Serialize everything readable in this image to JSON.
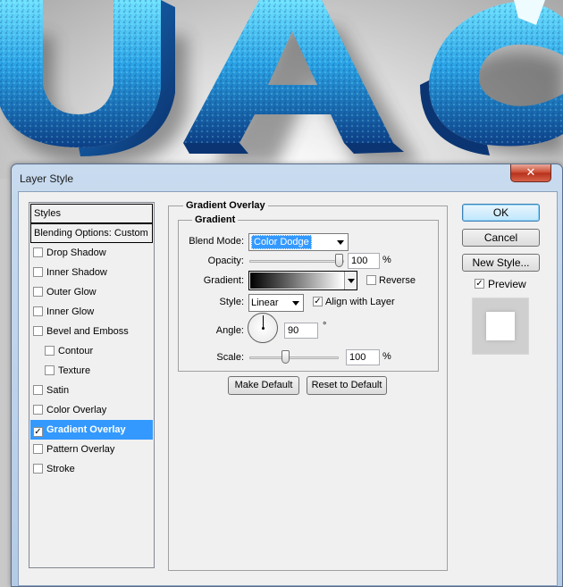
{
  "background": {
    "artwork_letters": "UAC",
    "colors": {
      "light_blue": "#5fd0f5",
      "mid_blue": "#1d8fd6",
      "dark_blue": "#0b3c7a"
    }
  },
  "dialog": {
    "title": "Layer Style",
    "close_glyph": "✕"
  },
  "styles_list": {
    "header": "Styles",
    "blending": "Blending Options: Custom",
    "items": [
      {
        "label": "Drop Shadow",
        "checked": false,
        "indent": false,
        "selected": false
      },
      {
        "label": "Inner Shadow",
        "checked": false,
        "indent": false,
        "selected": false
      },
      {
        "label": "Outer Glow",
        "checked": false,
        "indent": false,
        "selected": false
      },
      {
        "label": "Inner Glow",
        "checked": false,
        "indent": false,
        "selected": false
      },
      {
        "label": "Bevel and Emboss",
        "checked": false,
        "indent": false,
        "selected": false
      },
      {
        "label": "Contour",
        "checked": false,
        "indent": true,
        "selected": false
      },
      {
        "label": "Texture",
        "checked": false,
        "indent": true,
        "selected": false
      },
      {
        "label": "Satin",
        "checked": false,
        "indent": false,
        "selected": false
      },
      {
        "label": "Color Overlay",
        "checked": false,
        "indent": false,
        "selected": false
      },
      {
        "label": "Gradient Overlay",
        "checked": true,
        "indent": false,
        "selected": true
      },
      {
        "label": "Pattern Overlay",
        "checked": false,
        "indent": false,
        "selected": false
      },
      {
        "label": "Stroke",
        "checked": false,
        "indent": false,
        "selected": false
      }
    ]
  },
  "gradient_overlay": {
    "section_title": "Gradient Overlay",
    "group_title": "Gradient",
    "blend_mode": {
      "label": "Blend Mode:",
      "value": "Color Dodge"
    },
    "opacity": {
      "label": "Opacity:",
      "value": "100",
      "unit": "%",
      "level": 1.0
    },
    "gradient": {
      "label": "Gradient:",
      "reverse_label": "Reverse",
      "reverse_checked": false
    },
    "style": {
      "label": "Style:",
      "value": "Linear",
      "align_label": "Align with Layer",
      "align_checked": true
    },
    "angle": {
      "label": "Angle:",
      "value": "90",
      "unit": "°"
    },
    "scale": {
      "label": "Scale:",
      "value": "100",
      "unit": "%",
      "level": 0.4
    },
    "make_default": "Make Default",
    "reset_default": "Reset to Default"
  },
  "actions": {
    "ok": "OK",
    "cancel": "Cancel",
    "new_style": "New Style...",
    "preview_label": "Preview",
    "preview_checked": true
  },
  "check_glyph": "✓",
  "accent_color": "#3399ff"
}
